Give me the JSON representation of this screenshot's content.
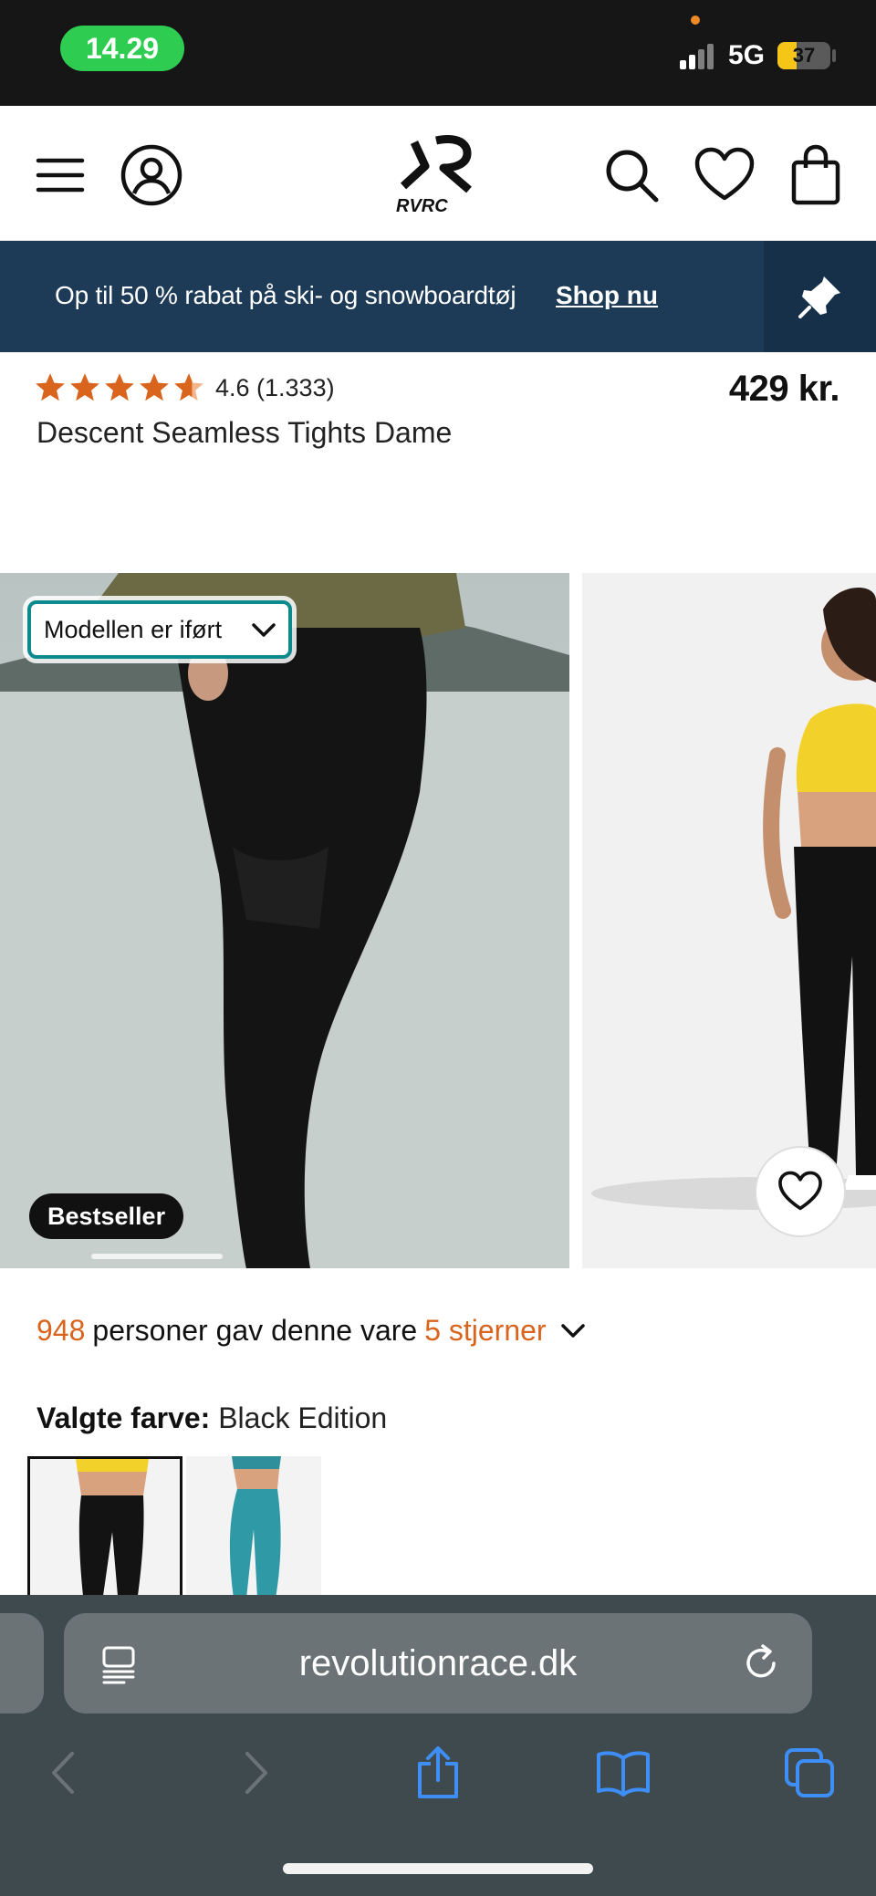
{
  "status_bar": {
    "time": "14.29",
    "network": "5G",
    "battery": "37",
    "battery_level": 0.37
  },
  "header": {
    "logo_text": "RVRC",
    "icons": [
      "menu-icon",
      "account-icon",
      "search-icon",
      "wishlist-icon",
      "cart-icon"
    ]
  },
  "promo": {
    "text": "Op til 50 % rabat på ski- og snowboardtøj",
    "link": "Shop nu"
  },
  "product": {
    "rating": 4.6,
    "rating_text": "4.6 (1.333)",
    "price": "429 kr.",
    "title": "Descent Seamless Tights Dame"
  },
  "gallery": {
    "model_worn_label": "Modellen er iført",
    "badge": "Bestseller"
  },
  "reviews": {
    "count": "948",
    "text_mid": "personer gav denne vare",
    "stars_label": "5 stjerner"
  },
  "color": {
    "label": "Valgte farve:",
    "value": "Black Edition"
  },
  "browser": {
    "url": "revolutionrace.dk"
  },
  "colors": {
    "accent_orange": "#d9641e",
    "banner_navy": "#1d3b57",
    "focus_teal": "#0d8a8e",
    "ios_blue": "#3e8ef7"
  }
}
